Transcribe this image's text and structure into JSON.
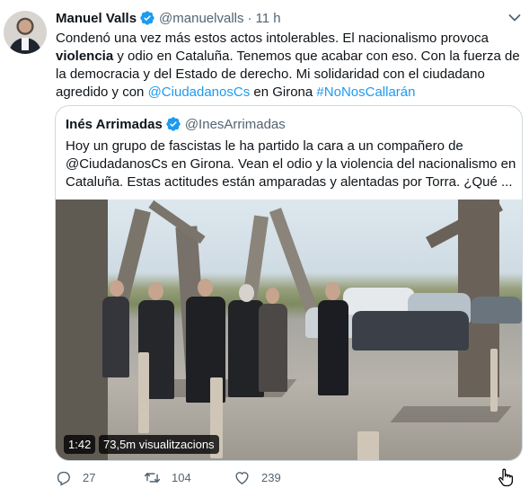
{
  "tweet": {
    "author_name": "Manuel Valls",
    "author_handle": "@manuelvalls",
    "separator": "·",
    "time": "11 h",
    "text": {
      "line1": "Condenó una vez más estos actos intolerables. El nacionalismo provoca",
      "line2_bold": "violencia",
      "line2_rest": " y odio en Cataluña. Tenemos que acabar con eso. Con la fuerza de",
      "line3": "la democracia y del Estado de derecho. Mi solidaridad con el ciudadano",
      "line4_pre": "agredido y con ",
      "line4_mention": "@CiudadanosCs",
      "line4_mid": " en Girona ",
      "line4_hashtag": "#NoNosCallarán"
    }
  },
  "quote": {
    "author_name": "Inés Arrimadas",
    "author_handle": "@InesArrimadas",
    "text": {
      "line1": "Hoy un grupo de fascistas le ha partido la cara a un compañero de",
      "line2": "@CiudadanosCs en Girona. Vean el odio y la violencia del nacionalismo en",
      "line3": "Cataluña. Estas actitudes están amparadas y alentadas por Torra. ¿Qué ..."
    },
    "video": {
      "duration": "1:42",
      "views": "73,5m visualitzacions"
    }
  },
  "actions": {
    "reply_count": "27",
    "retweet_count": "104",
    "like_count": "239"
  },
  "colors": {
    "accent": "#1d9bf0",
    "muted": "#536471",
    "border": "#cfd9de"
  },
  "icons": [
    "caret-down-icon",
    "verified-badge-icon",
    "reply-icon",
    "retweet-icon",
    "like-icon",
    "share-icon",
    "hand-cursor-icon"
  ]
}
